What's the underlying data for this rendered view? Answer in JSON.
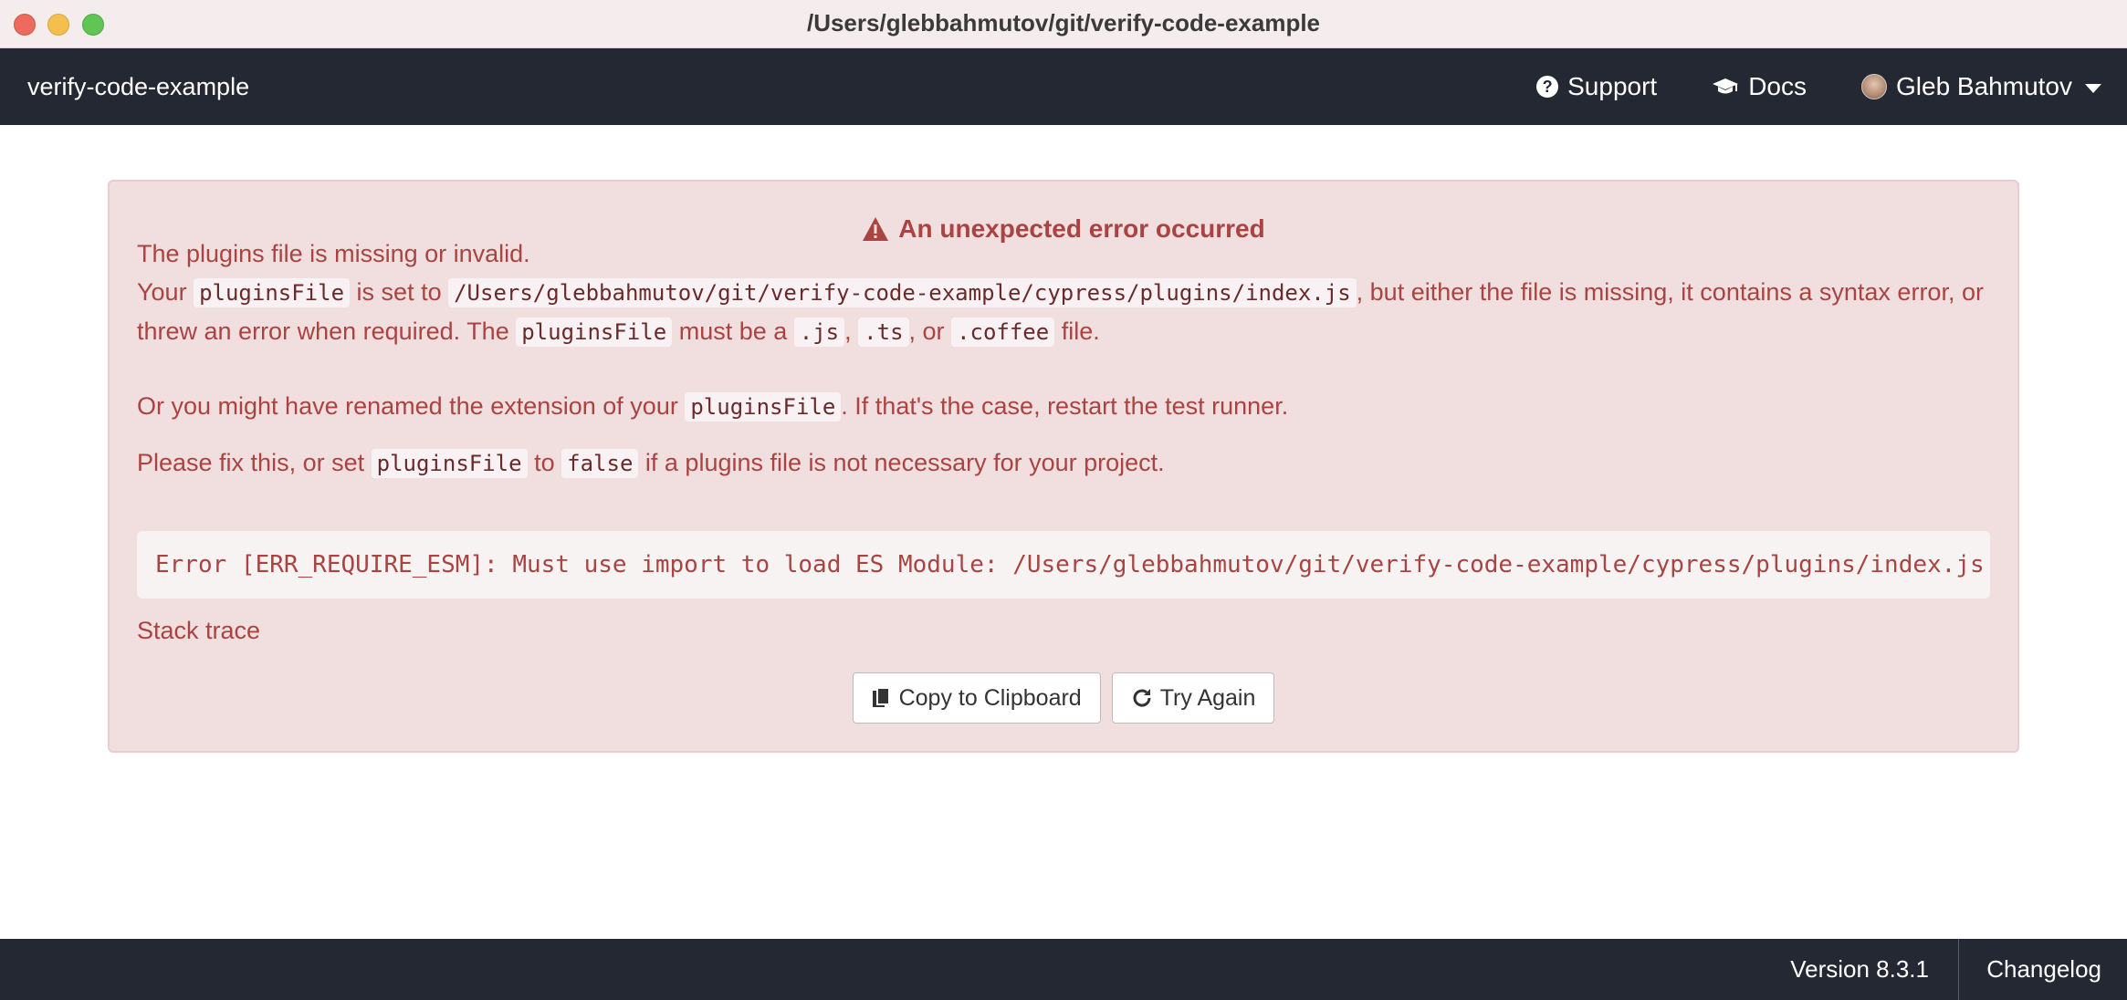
{
  "window": {
    "title": "/Users/glebbahmutov/git/verify-code-example"
  },
  "navbar": {
    "brand": "verify-code-example",
    "support_label": "Support",
    "docs_label": "Docs",
    "user_label": "Gleb Bahmutov"
  },
  "error": {
    "title": "An unexpected error occurred",
    "line1": "The plugins file is missing or invalid.",
    "p2": {
      "t1": "Your",
      "c1": "pluginsFile",
      "t2": "is set to",
      "c2": "/Users/glebbahmutov/git/verify-code-example/cypress/plugins/index.js",
      "t3": ", but either the file is missing, it contains a syntax error, or threw an error when required. The",
      "c3": "pluginsFile",
      "t4": "must be a",
      "c4": ".js",
      "t5": ",",
      "c5": ".ts",
      "t6": ", or",
      "c6": ".coffee",
      "t7": "file."
    },
    "p3": {
      "t1": "Or you might have renamed the extension of your",
      "c1": "pluginsFile",
      "t2": ". If that's the case, restart the test runner."
    },
    "p4": {
      "t1": "Please fix this, or set",
      "c1": "pluginsFile",
      "t2": "to",
      "c2": "false",
      "t3": "if a plugins file is not necessary for your project."
    },
    "code": "Error [ERR_REQUIRE_ESM]: Must use import to load ES Module: /Users/glebbahmutov/git/verify-code-example/cypress/plugins/index.js",
    "stack_label": "Stack trace",
    "copy_button": "Copy to Clipboard",
    "retry_button": "Try Again"
  },
  "footer": {
    "version": "Version 8.3.1",
    "changelog": "Changelog"
  },
  "colors": {
    "error_text": "#a94442",
    "panel_bg": "#f1dede",
    "nav_bg": "#242833"
  }
}
